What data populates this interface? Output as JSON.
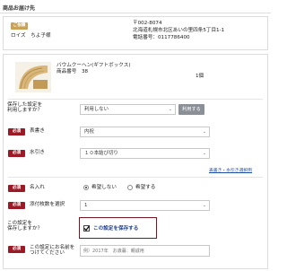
{
  "header": {
    "title": "商品お届け先"
  },
  "recipient": {
    "badge": "ご依頼",
    "name": "ロイズ　ちよ子様",
    "postal": "〒002-8074",
    "address": "北海道札幌市北区あいの里四条5丁目1-1",
    "phone": "電話番号：0117786400"
  },
  "product": {
    "name": "バウムクーヘン(ギフトボックス)",
    "code": "商品番号　38",
    "quantity": "1個"
  },
  "form": {
    "saved_settings_label": "保存した設定を\n利用しますか？",
    "saved_settings_value": "利用しない",
    "apply_button": "利用する",
    "required_badge": "必須",
    "omote_label": "表書き",
    "omote_value": "内祝",
    "mizuhiki_label": "水引き",
    "mizuhiki_value": "１０本結び切り",
    "noshi_link": "表書き・水引き選択例",
    "name_label": "名入れ",
    "name_option_no": "希望しない",
    "name_option_yes": "希望する",
    "attach_label": "添付枚数を選択",
    "attach_value": "1",
    "save_label": "この設定を\n保存しますか？",
    "save_checkbox_label": "この設定を保存する",
    "setting_name_label": "この設定にお名前を\nつけてください",
    "setting_name_placeholder": "例）2017年　お歳暮：親戚用"
  },
  "colors": {
    "accent_red": "#9c1a26",
    "gold": "#c8a257"
  }
}
